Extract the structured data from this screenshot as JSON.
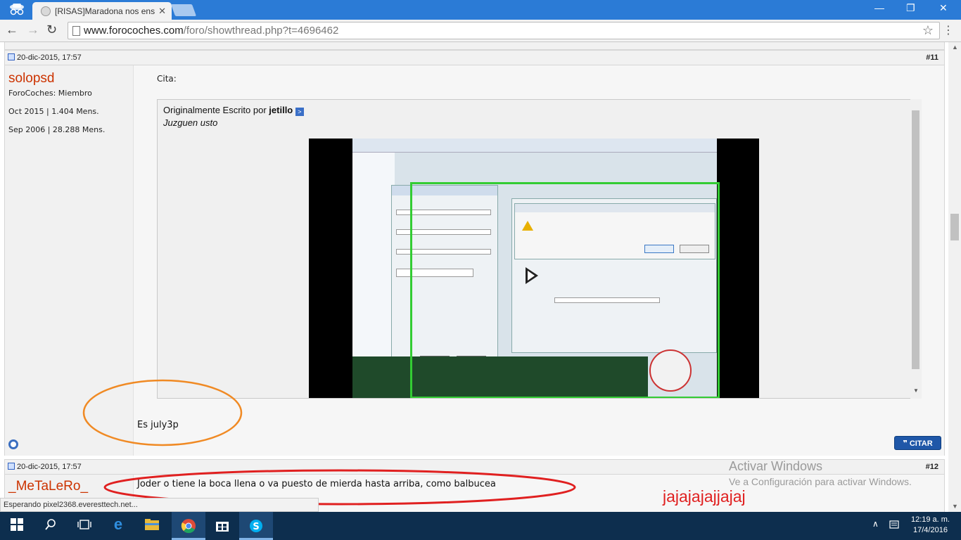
{
  "browser": {
    "tab_title": "[RISAS]Maradona nos ens",
    "tab_close": "✕",
    "url_host": "www.forocoches.com",
    "url_path": "/foro/showthread.php?t=4696462",
    "win_min": "—",
    "win_restore": "❐",
    "win_close": "✕",
    "back": "←",
    "forward": "→",
    "reload": "↻",
    "star": "☆",
    "menu": "⋮"
  },
  "post11": {
    "date": "20-dic-2015, 17:57",
    "number": "#11",
    "username": "solopsd",
    "rank": "ForoCoches: Miembro",
    "stat1": "Oct 2015 | 1.404 Mens.",
    "stat2": "Sep 2006 | 28.288 Mens.",
    "quote_label": "Cita:",
    "quote_prefix": "Originalmente Escrito por",
    "quote_author": "jetillo",
    "quote_text": "Juzguen usto",
    "reply": "Es july3p",
    "citar": "CITAR"
  },
  "post12": {
    "date": "20-dic-2015, 17:57",
    "number": "#12",
    "username": "_MeTaLeRo_",
    "message": "Joder o tiene la boca llena o va puesto de mierda hasta arriba, como balbucea"
  },
  "overlay": {
    "activate_title": "Activar Windows",
    "activate_sub": "Ve a Configuración para activar Windows.",
    "laugh": "jajajajajjajaj",
    "orange": "#f08a24",
    "red": "#e02020"
  },
  "status": {
    "text": "Esperando pixel2368.everesttech.net..."
  },
  "taskbar": {
    "time": "12:19 a. m.",
    "date": "17/4/2016",
    "icons": [
      "windows-start-icon",
      "search-icon",
      "task-view-icon",
      "edge-icon",
      "file-explorer-icon",
      "chrome-icon",
      "store-icon",
      "skype-icon"
    ]
  }
}
